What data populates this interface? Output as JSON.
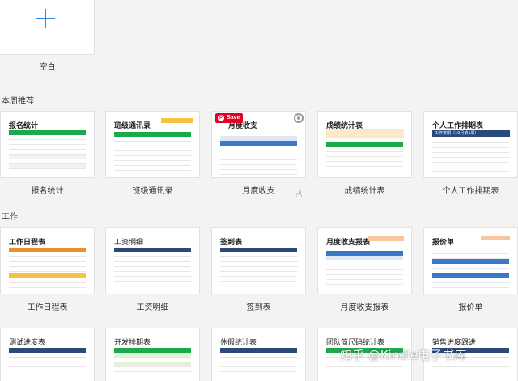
{
  "blank": {
    "label": "空白"
  },
  "sections": {
    "weekly": "本周推荐",
    "work": "工作"
  },
  "weekly_cards": [
    {
      "title": "报名统计",
      "label": "报名统计"
    },
    {
      "title": "班级通讯录",
      "label": "班级通讯录"
    },
    {
      "title": "月度收支",
      "label": "月度收支"
    },
    {
      "title": "成绩统计表",
      "label": "成绩统计表"
    },
    {
      "title": "个人工作排期表",
      "label": "个人工作排期表",
      "inner_title": "工作排期（10月第1周）"
    }
  ],
  "work_cards": [
    {
      "title": "工作日程表",
      "label": "工作日程表"
    },
    {
      "title": "工资明细",
      "label": "工资明细"
    },
    {
      "title": "签到表",
      "label": "签到表"
    },
    {
      "title": "月度收支报表",
      "label": "月度收支报表"
    },
    {
      "title": "报价单",
      "label": "报价单"
    }
  ],
  "row3_cards": [
    {
      "title": "测试进度表"
    },
    {
      "title": "开发排期表"
    },
    {
      "title": "休假统计表"
    },
    {
      "title": "团队简尺码统计表"
    },
    {
      "title": "销售进度跟进"
    }
  ],
  "overlay": {
    "save": "Save",
    "pin_glyph": "P",
    "watermark": "知乎 @Kindle电子书库"
  },
  "colors": {
    "green": "#1ba94c",
    "blue": "#3c78c8",
    "navy": "#2b4a7a",
    "orange": "#ef8f2c",
    "yellow": "#f5c243",
    "plus": "#2f8ae5",
    "pinterest": "#e60023"
  }
}
